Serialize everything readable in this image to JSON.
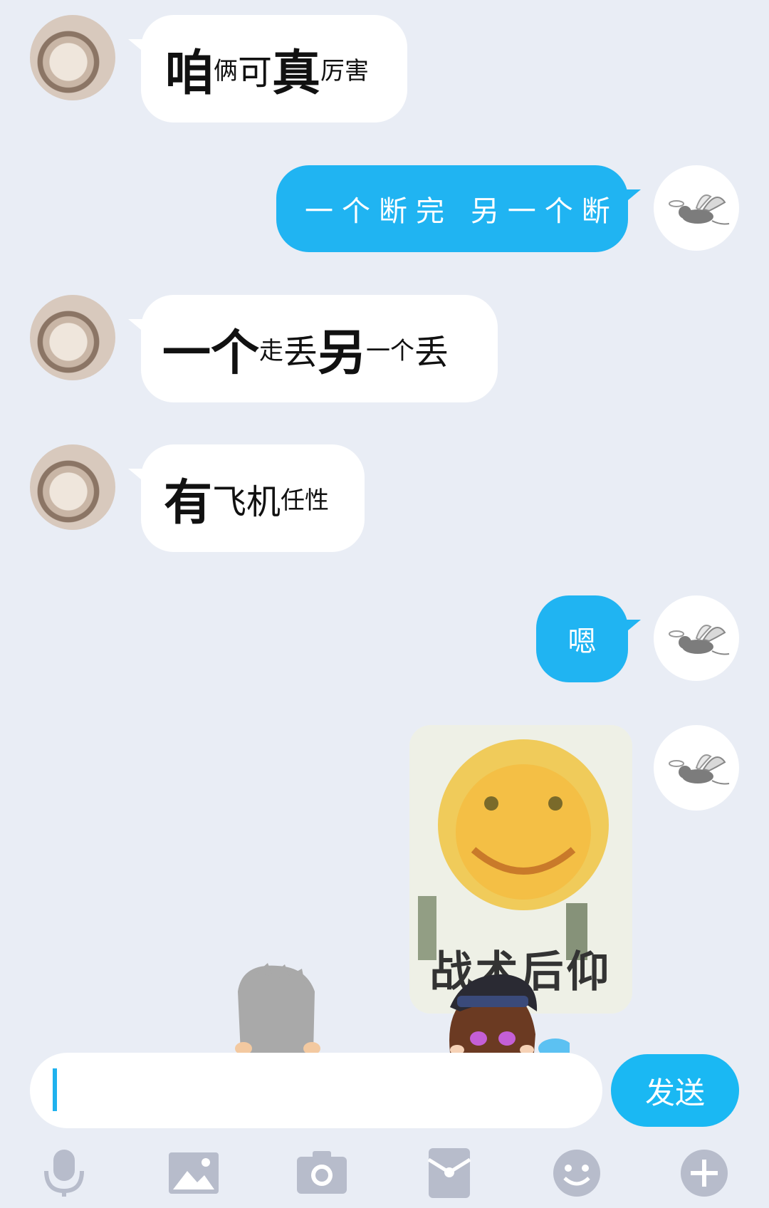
{
  "messages": [
    {
      "id": "m1",
      "side": "in",
      "parts": [
        {
          "t": "咱",
          "size": "big"
        },
        {
          "t": "俩",
          "size": "small"
        },
        {
          "t": "可",
          "size": "mid"
        },
        {
          "t": "真",
          "size": "big"
        },
        {
          "t": "厉害",
          "size": "small"
        }
      ]
    },
    {
      "id": "m2",
      "side": "out",
      "text": "一个断完 另一个断"
    },
    {
      "id": "m3",
      "side": "in",
      "parts": [
        {
          "t": "一个",
          "size": "big"
        },
        {
          "t": "走",
          "size": "small"
        },
        {
          "t": "丢",
          "size": "mid"
        },
        {
          "t": "另",
          "size": "big"
        },
        {
          "t": "一个",
          "size": "small"
        },
        {
          "t": "丢",
          "size": "mid"
        }
      ]
    },
    {
      "id": "m4",
      "side": "in",
      "parts": [
        {
          "t": "有",
          "size": "big"
        },
        {
          "t": "飞机",
          "size": "mid"
        },
        {
          "t": "任性",
          "size": "small"
        }
      ]
    },
    {
      "id": "m5",
      "side": "out",
      "text": "嗯"
    },
    {
      "id": "m6",
      "side": "out",
      "type": "image",
      "caption": "战术后仰"
    }
  ],
  "input": {
    "value": "",
    "placeholder": ""
  },
  "send_label": "发送",
  "toolbar": [
    "microphone-icon",
    "image-icon",
    "camera-icon",
    "red-packet-icon",
    "emoji-icon",
    "plus-icon"
  ],
  "colors": {
    "accent": "#1ab8f3",
    "background": "#e9edf5",
    "bubble_in": "#ffffff",
    "bubble_out": "#20b4f2"
  }
}
